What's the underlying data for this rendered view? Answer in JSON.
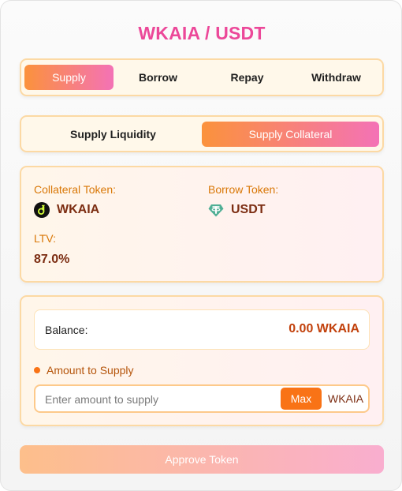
{
  "title": "WKAIA / USDT",
  "tabs": [
    {
      "label": "Supply",
      "active": true
    },
    {
      "label": "Borrow",
      "active": false
    },
    {
      "label": "Repay",
      "active": false
    },
    {
      "label": "Withdraw",
      "active": false
    }
  ],
  "subtabs": [
    {
      "label": "Supply Liquidity",
      "active": false
    },
    {
      "label": "Supply Collateral",
      "active": true
    }
  ],
  "info": {
    "collateral_label": "Collateral Token:",
    "collateral_token": "WKAIA",
    "collateral_icon": "kaia-icon",
    "borrow_label": "Borrow Token:",
    "borrow_token": "USDT",
    "borrow_icon": "tether-icon",
    "ltv_label": "LTV:",
    "ltv_value": "87.0%"
  },
  "supply": {
    "balance_label": "Balance:",
    "balance_value": "0.00 WKAIA",
    "amount_label": "Amount to Supply",
    "input_placeholder": "Enter amount to supply",
    "input_value": "",
    "max_label": "Max",
    "unit": "WKAIA"
  },
  "approve_label": "Approve Token",
  "colors": {
    "accent_orange": "#fb923c",
    "accent_pink": "#f472b6",
    "title_pink": "#ec4899",
    "balance_red": "#c2410c"
  }
}
